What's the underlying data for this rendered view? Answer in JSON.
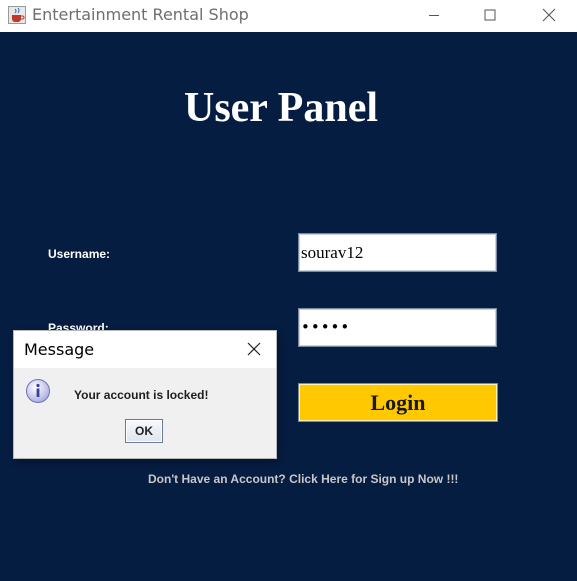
{
  "window": {
    "title": "Entertainment Rental Shop",
    "icon": "java-cup-icon",
    "controls": [
      "minimize-icon",
      "maximize-icon",
      "close-icon"
    ]
  },
  "panel": {
    "heading": "User Panel",
    "username_label": "Username:",
    "username_value": "sourav12",
    "password_label": "Password:",
    "password_value": "•••••",
    "login_label": "Login",
    "signup_text": "Don't Have an Account? Click Here for Sign up Now !!!"
  },
  "dialog": {
    "title": "Message",
    "icon": "info-icon",
    "message": "Your account is locked!",
    "ok_label": "OK"
  },
  "colors": {
    "background": "#061d42",
    "login_button": "#ffc800"
  }
}
